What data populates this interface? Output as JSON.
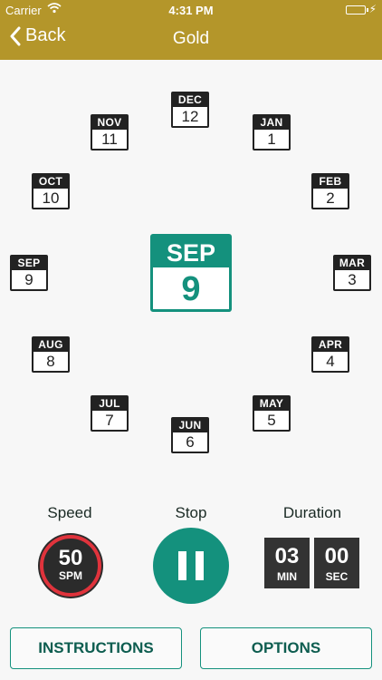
{
  "status_bar": {
    "carrier": "Carrier",
    "time": "4:31 PM"
  },
  "nav": {
    "back_label": "Back",
    "title": "Gold"
  },
  "months": [
    {
      "mon": "DEC",
      "day": "12"
    },
    {
      "mon": "JAN",
      "day": "1"
    },
    {
      "mon": "FEB",
      "day": "2"
    },
    {
      "mon": "MAR",
      "day": "3"
    },
    {
      "mon": "APR",
      "day": "4"
    },
    {
      "mon": "MAY",
      "day": "5"
    },
    {
      "mon": "JUN",
      "day": "6"
    },
    {
      "mon": "JUL",
      "day": "7"
    },
    {
      "mon": "AUG",
      "day": "8"
    },
    {
      "mon": "SEP",
      "day": "9"
    },
    {
      "mon": "OCT",
      "day": "10"
    },
    {
      "mon": "NOV",
      "day": "11"
    }
  ],
  "current": {
    "mon": "SEP",
    "day": "9"
  },
  "controls": {
    "speed_label": "Speed",
    "speed_value": "50",
    "speed_unit": "SPM",
    "stop_label": "Stop",
    "duration_label": "Duration",
    "duration_min": "03",
    "duration_min_unit": "MIN",
    "duration_sec": "00",
    "duration_sec_unit": "SEC"
  },
  "buttons": {
    "instructions": "INSTRUCTIONS",
    "options": "OPTIONS"
  },
  "colors": {
    "header": "#b4962a",
    "accent": "#14917d",
    "speed_ring": "#e0333c"
  }
}
